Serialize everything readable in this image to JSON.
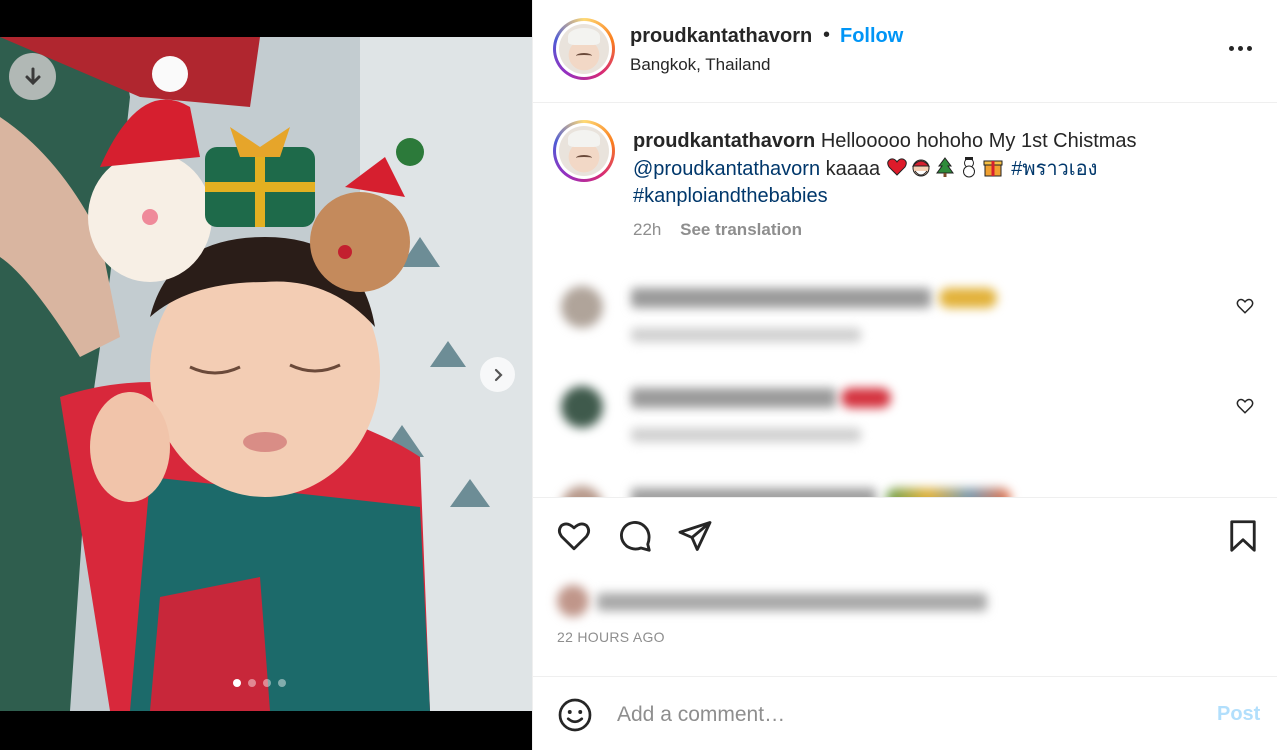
{
  "post": {
    "username": "proudkantathavorn",
    "separator": "•",
    "follow_label": "Follow",
    "location": "Bangkok, Thailand",
    "more_label": "More options"
  },
  "caption": {
    "username": "proudkantathavorn",
    "text": "Hellooooo hohoho My 1st Chistmas",
    "mention": "@proudkantathavorn",
    "after_mention": "kaaaa",
    "emojis": [
      "heart-emoji",
      "santa-emoji",
      "tree-emoji",
      "snowman-emoji",
      "gift-emoji"
    ],
    "hashtag1": "#พราวเอง",
    "hashtag2": "#kanploiandthebabies",
    "time": "22h",
    "see_translation": "See translation"
  },
  "comments": [
    {
      "blurred": true,
      "text": "nuen_liguiti annpunntibirnthibirkau",
      "meta": "11h  Reply  See translation"
    },
    {
      "blurred": true,
      "text": "pim_pim_30 iqsuurni",
      "meta": "11h  Reply  See translation"
    },
    {
      "blurred": true,
      "text": "nim_49400 tinsei thurvunu",
      "meta": ""
    }
  ],
  "likes": {
    "blurred": true,
    "text": "Liked by kanhamtathavorn and 983 others"
  },
  "timestamp": "22 HOURS AGO",
  "comment_input": {
    "placeholder": "Add a comment…",
    "post_label": "Post"
  },
  "media": {
    "slide_index": 1,
    "slide_count": 4
  },
  "colors": {
    "follow": "#0095f6",
    "link": "#00376b",
    "muted": "#8e8e8e",
    "post_disabled": "#b2dffc"
  }
}
